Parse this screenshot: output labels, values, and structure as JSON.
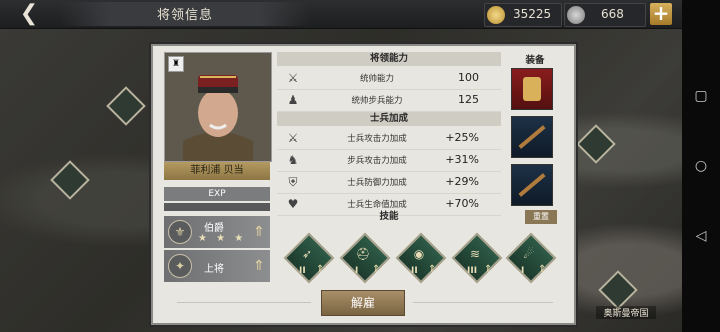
{
  "header": {
    "back_icon": "back-arrow-icon",
    "title": "将领信息",
    "gold": "35225",
    "silver": "668",
    "add_icon": "plus-icon"
  },
  "general": {
    "name": "菲利浦 贝当",
    "exp_label": "EXP",
    "exp_fraction": 0.0,
    "rank1_title": "伯爵",
    "rank1_stars": "★ ★ ★",
    "rank2_title": "上将"
  },
  "sections": {
    "general_ability": "将领能力",
    "soldier_bonus": "士兵加成",
    "skills": "技能",
    "equipment": "装备"
  },
  "general_ability": [
    {
      "label": "统帅能力",
      "value": "100",
      "icon": "crossed-swords-icon"
    },
    {
      "label": "统帅步兵能力",
      "value": "125",
      "icon": "infantry-icon"
    }
  ],
  "soldier_bonus": [
    {
      "label": "士兵攻击力加成",
      "value": "+25%",
      "icon": "attack-icon"
    },
    {
      "label": "步兵攻击力加成",
      "value": "+31%",
      "icon": "infantry-attack-icon"
    },
    {
      "label": "士兵防御力加成",
      "value": "+29%",
      "icon": "defense-icon"
    },
    {
      "label": "士兵生命值加成",
      "value": "+70%",
      "icon": "health-icon"
    }
  ],
  "skills": [
    {
      "level": "II",
      "icon": "charge-skill-icon"
    },
    {
      "level": "I",
      "icon": "helmet-skill-icon"
    },
    {
      "level": "II",
      "icon": "eye-skill-icon"
    },
    {
      "level": "III",
      "icon": "wave-skill-icon"
    },
    {
      "level": "I",
      "icon": "artillery-skill-icon"
    }
  ],
  "buttons": {
    "reset": "重置",
    "dismiss": "解雇"
  },
  "map": {
    "label": "奥斯曼帝国"
  },
  "colors": {
    "panel": "#e8e6e0",
    "gold_coin": "#d9b45a",
    "accent": "#8a7756"
  }
}
